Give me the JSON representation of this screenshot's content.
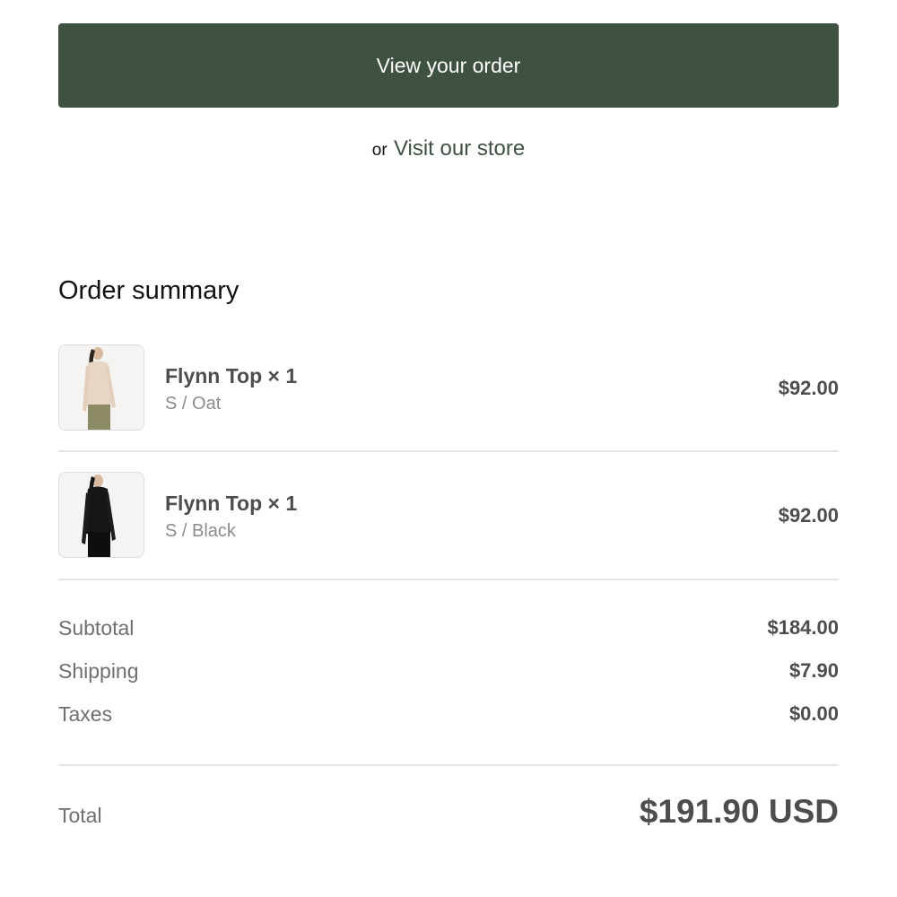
{
  "cta": {
    "label": "View your order"
  },
  "alt": {
    "prefix": "or",
    "link_label": "Visit our store"
  },
  "summary": {
    "title": "Order summary"
  },
  "items": [
    {
      "name": "Flynn Top × 1",
      "variant": "S / Oat",
      "price": "$92.00",
      "color": "#e8d6c4"
    },
    {
      "name": "Flynn Top × 1",
      "variant": "S / Black",
      "price": "$92.00",
      "color": "#141414"
    }
  ],
  "totals": {
    "subtotal_label": "Subtotal",
    "subtotal_value": "$184.00",
    "shipping_label": "Shipping",
    "shipping_value": "$7.90",
    "taxes_label": "Taxes",
    "taxes_value": "$0.00",
    "total_label": "Total",
    "total_value": "$191.90 USD"
  },
  "colors": {
    "accent": "#3f5141"
  }
}
